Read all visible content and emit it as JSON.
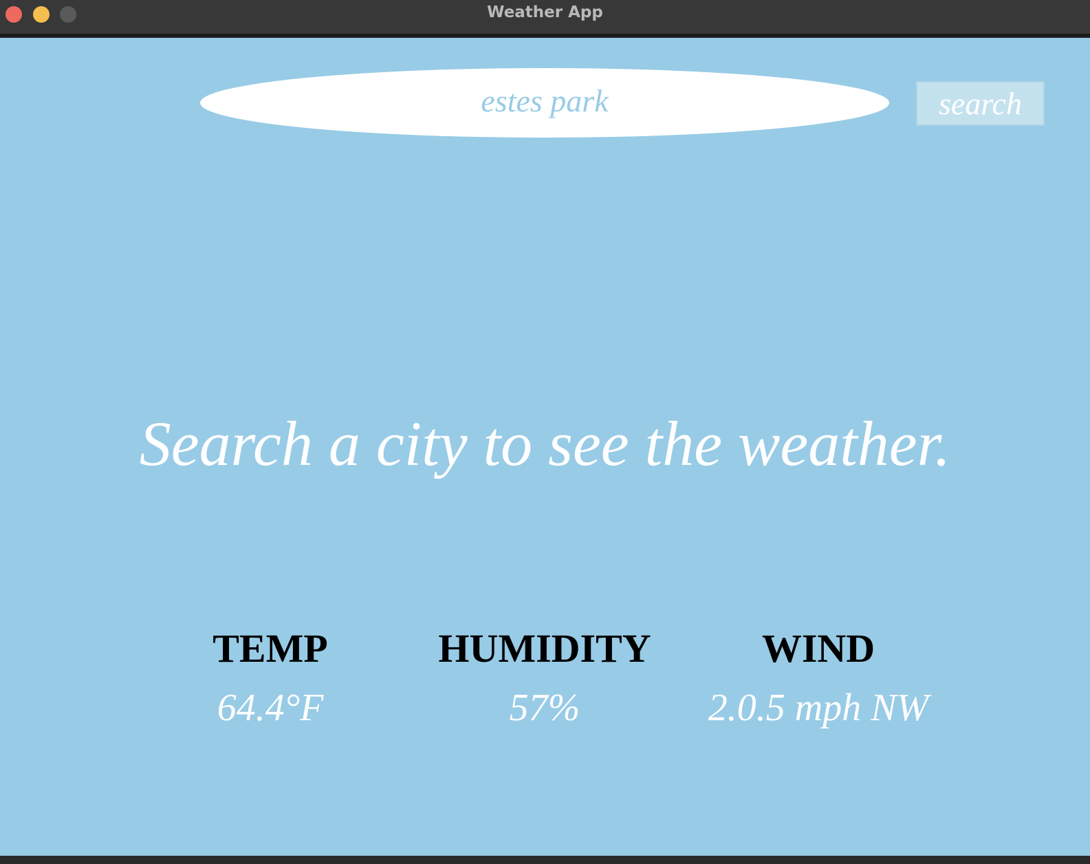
{
  "window": {
    "title": "Weather App"
  },
  "search": {
    "value": "estes park",
    "button_label": "search"
  },
  "main": {
    "headline": "Search a city to see the weather."
  },
  "stats": {
    "temp": {
      "label": "TEMP",
      "value": "64.4°F"
    },
    "humidity": {
      "label": "HUMIDITY",
      "value": "57%"
    },
    "wind": {
      "label": "WIND",
      "value": "2.0.5 mph NW"
    }
  },
  "colors": {
    "background": "#98cbe6",
    "titlebar": "#383838",
    "close": "#ee6a5e",
    "minimize": "#f5bf4f",
    "zoom": "#5a5a5a",
    "text_light": "#ffffff",
    "text_dark": "#000000"
  }
}
